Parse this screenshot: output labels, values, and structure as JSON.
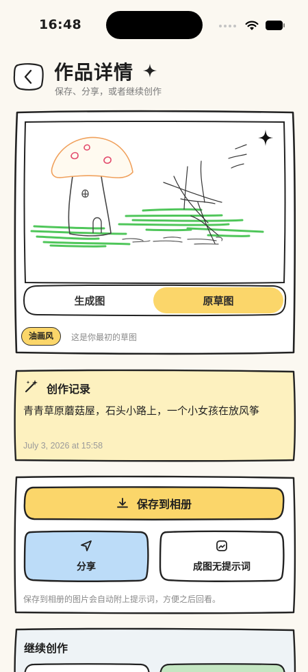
{
  "status_bar": {
    "time": "16:48"
  },
  "header": {
    "title": "作品详情",
    "subtitle": "保存、分享，或者继续创作"
  },
  "artwork": {
    "tabs": [
      {
        "label": "生成图",
        "selected": false
      },
      {
        "label": "原草图",
        "selected": true
      }
    ],
    "style_badge": "油画风",
    "caption": "这是你最初的草图"
  },
  "record": {
    "title": "创作记录",
    "prompt": "青青草原蘑菇屋，石头小路上，一个小女孩在放风筝",
    "date": "July 3, 2026 at 15:58"
  },
  "actions": {
    "save_label": "保存到相册",
    "share_label": "分享",
    "no_prompt_label": "成图无提示词",
    "note": "保存到相册的图片会自动附上提示词，方便之后回看。"
  },
  "continue": {
    "title": "继续创作"
  },
  "colors": {
    "accent_yellow": "#fbd66a",
    "record_bg": "#fdf1bf",
    "share_bg": "#bcdcf8",
    "page_bg": "#fbf8f1",
    "continue_bg": "#eef3f6",
    "grass_green": "#4fc65a",
    "mushroom_orange": "#f0a05b",
    "mushroom_spot": "#e2476a"
  },
  "icons": {
    "back": "chevron-left-icon",
    "sparkle": "sparkle-icon",
    "record": "magic-wand-icon",
    "save": "download-icon",
    "share": "send-icon",
    "no_prompt": "image-icon"
  }
}
